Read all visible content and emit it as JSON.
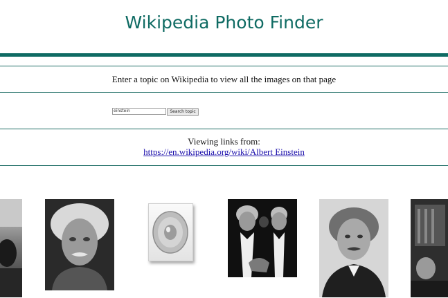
{
  "header": {
    "title": "Wikipedia Photo Finder"
  },
  "intro": {
    "instruction": "Enter a topic on Wikipedia to view all the images on that page"
  },
  "search": {
    "value": "einstein",
    "button_label": "Search topic"
  },
  "result": {
    "viewing_label": "Viewing links from:",
    "url": "https://en.wikipedia.org/wiki/Albert Einstein"
  },
  "gallery": {
    "images": [
      {
        "name": "photo-partial-left"
      },
      {
        "name": "einstein-portrait-photo"
      },
      {
        "name": "audio-speaker-icon"
      },
      {
        "name": "einstein-and-chaplin-photo"
      },
      {
        "name": "einstein-suit-portrait-photo"
      },
      {
        "name": "photo-partial-right"
      }
    ]
  },
  "colors": {
    "accent": "#0f6b63",
    "link": "#1a0dab",
    "text": "#111111"
  }
}
